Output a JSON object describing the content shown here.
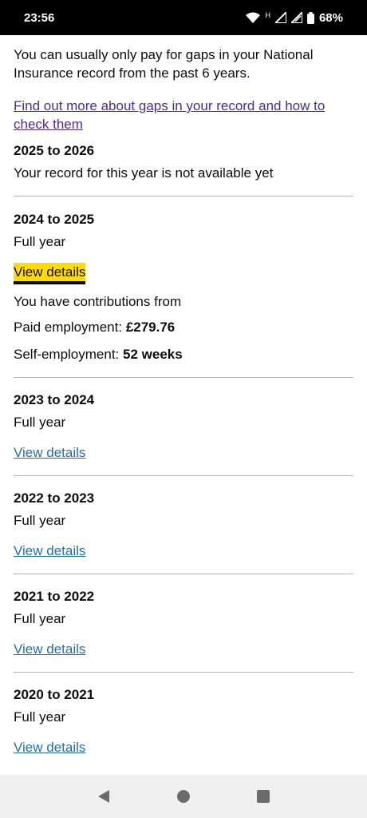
{
  "status_bar": {
    "time": "23:56",
    "network_h": "H",
    "battery_pct": "68%"
  },
  "intro": {
    "text": "You can usually only pay for gaps in your National Insurance record from the past 6 years.",
    "link": "Find out more about gaps in your record and how to check them"
  },
  "years": [
    {
      "title": "2025 to 2026",
      "status": "Your record for this year is not available yet"
    },
    {
      "title": "2024 to 2025",
      "status": "Full year",
      "link": "View details",
      "contributions_heading": "You have contributions from",
      "paid_label": "Paid employment:",
      "paid_value": "£279.76",
      "self_label": "Self-employment:",
      "self_value": "52 weeks"
    },
    {
      "title": "2023 to 2024",
      "status": "Full year",
      "link": "View details"
    },
    {
      "title": "2022 to 2023",
      "status": "Full year",
      "link": "View details"
    },
    {
      "title": "2021 to 2022",
      "status": "Full year",
      "link": "View details"
    },
    {
      "title": "2020 to 2021",
      "status": "Full year",
      "link": "View details"
    }
  ],
  "nav_bar": {
    "back_icon": "back-triangle-icon",
    "home_icon": "home-circle-icon",
    "recents_icon": "recents-square-icon"
  }
}
